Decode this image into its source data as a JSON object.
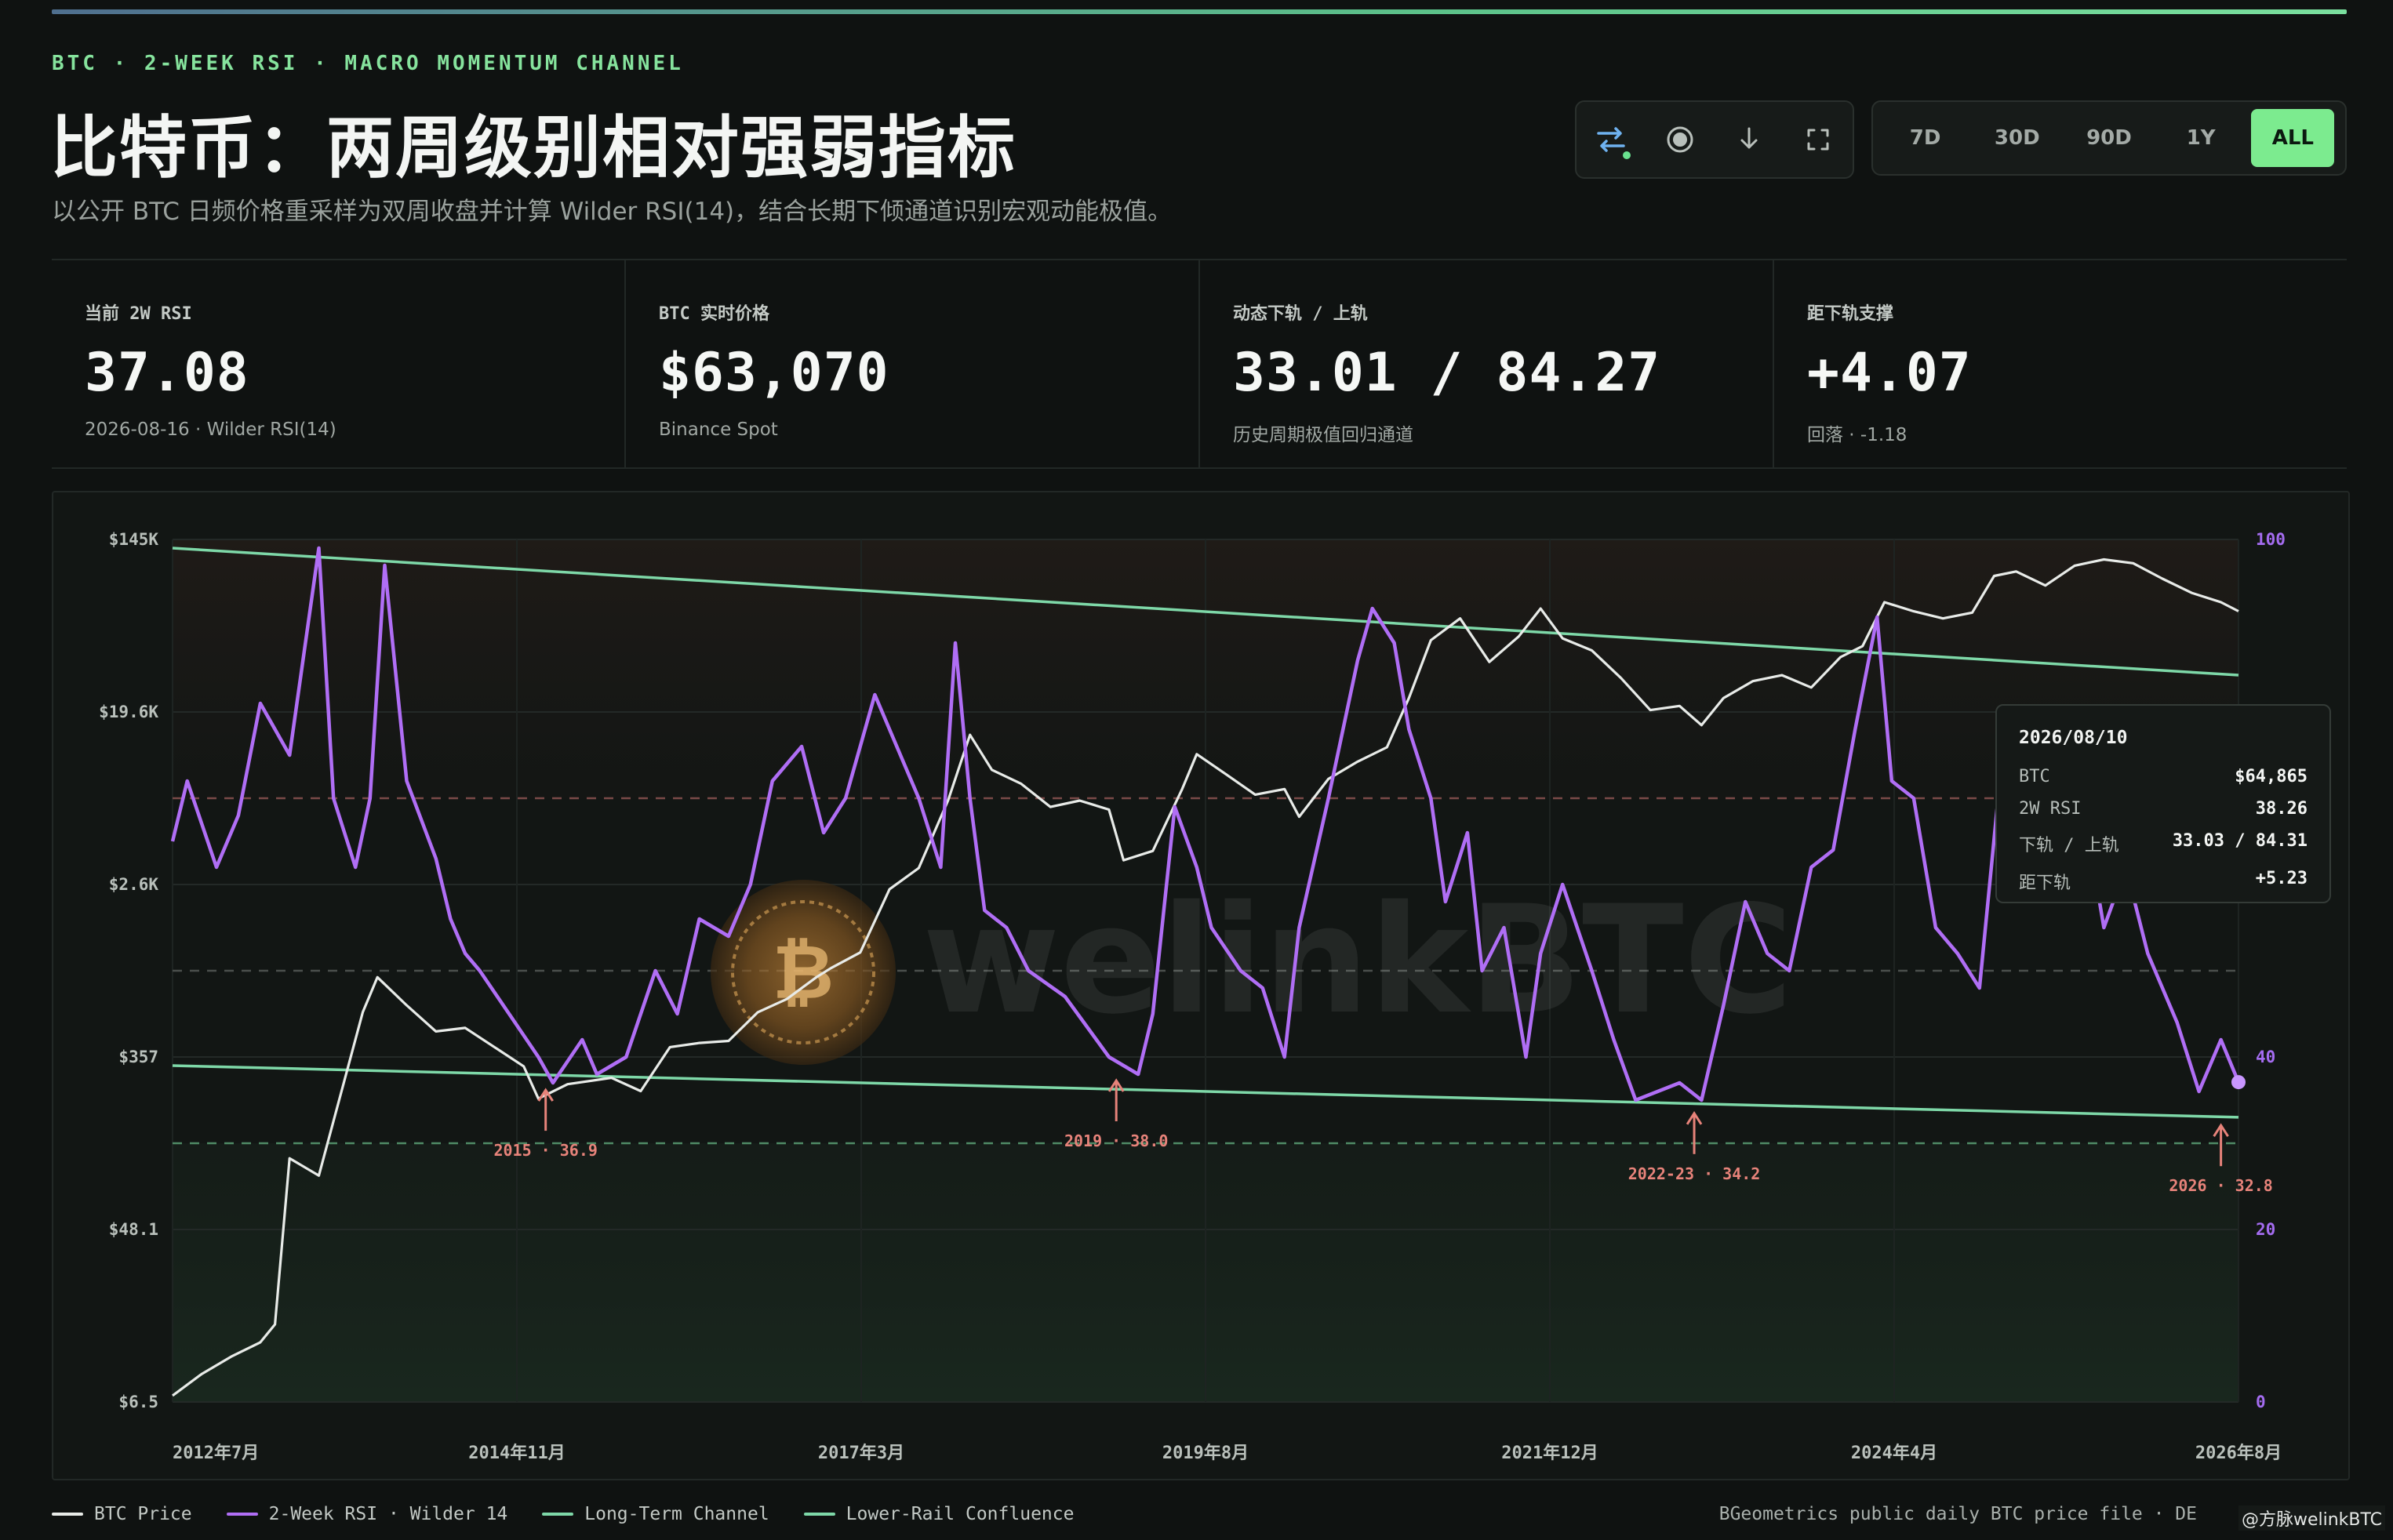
{
  "header": {
    "eyebrow": "BTC · 2-WEEK RSI · MACRO MOMENTUM CHANNEL",
    "title": "比特币：两周级别相对强弱指标",
    "subtitle": "以公开 BTC 日频价格重采样为双周收盘并计算 Wilder RSI(14)，结合长期下倾通道识别宏观动能极值。"
  },
  "toolbar": {
    "icons": [
      "swap-arrows-icon",
      "record-circle-icon",
      "download-arrow-icon",
      "fullscreen-icon"
    ],
    "ranges": [
      "7D",
      "30D",
      "90D",
      "1Y",
      "ALL"
    ],
    "active_range": "ALL",
    "accent": "#7ceb8f"
  },
  "stats": [
    {
      "label": "当前 2W RSI",
      "value": "37.08",
      "sub": "2026-08-16 · Wilder RSI(14)"
    },
    {
      "label": "BTC 实时价格",
      "value": "$63,070",
      "sub": "Binance Spot"
    },
    {
      "label": "动态下轨 / 上轨",
      "value": "33.01 / 84.27",
      "sub": "历史周期极值回归通道"
    },
    {
      "label": "距下轨支撑",
      "value": "+4.07",
      "sub": "回落 · -1.18"
    }
  ],
  "tooltip": {
    "date": "2026/08/10",
    "rows": [
      {
        "k": "BTC",
        "v": "$64,865"
      },
      {
        "k": "2W RSI",
        "v": "38.26"
      },
      {
        "k": "下轨 / 上轨",
        "v": "33.03 / 84.31"
      },
      {
        "k": "距下轨",
        "v": "+5.23"
      }
    ]
  },
  "legend": {
    "items": [
      {
        "label": "BTC Price",
        "color": "#e8ebe8"
      },
      {
        "label": "2-Week RSI · Wilder 14",
        "color": "#b06ef5"
      },
      {
        "label": "Long-Term Channel",
        "color": "#7ed8a8"
      },
      {
        "label": "Lower-Rail Confluence",
        "color": "#7ed8a8"
      }
    ],
    "source": "BGeometrics public daily BTC price file · DE",
    "credit": "@方脉welinkBTC"
  },
  "watermark": "welinkBTC",
  "chart_data": {
    "type": "line",
    "x_tick_labels": [
      "2012年7月",
      "2014年11月",
      "2017年3月",
      "2019年8月",
      "2021年12月",
      "2024年4月",
      "2026年8月"
    ],
    "left_axis": {
      "scale": "log",
      "tick_labels": [
        "$145K",
        "$19.6K",
        "$2.6K",
        "$357",
        "$48.1",
        "$6.5"
      ],
      "range": [
        6.5,
        145000
      ]
    },
    "right_axis": {
      "tick_labels": [
        "100",
        "40",
        "20",
        "0"
      ],
      "range": [
        0,
        100
      ]
    },
    "reference_lines": [
      70,
      50,
      30
    ],
    "series": [
      {
        "name": "BTC Price",
        "color": "#e8ebe8",
        "x": [
          2012.5,
          2012.7,
          2012.9,
          2013.1,
          2013.2,
          2013.3,
          2013.5,
          2013.8,
          2013.9,
          2014.1,
          2014.3,
          2014.5,
          2014.7,
          2014.9,
          2015.0,
          2015.2,
          2015.5,
          2015.7,
          2015.9,
          2016.1,
          2016.3,
          2016.5,
          2016.7,
          2016.9,
          2017.0,
          2017.2,
          2017.4,
          2017.6,
          2017.8,
          2017.95,
          2018.1,
          2018.3,
          2018.5,
          2018.7,
          2018.9,
          2019.0,
          2019.2,
          2019.4,
          2019.5,
          2019.7,
          2019.9,
          2020.1,
          2020.2,
          2020.4,
          2020.6,
          2020.8,
          2020.95,
          2021.1,
          2021.3,
          2021.5,
          2021.7,
          2021.85,
          2022.0,
          2022.2,
          2022.4,
          2022.6,
          2022.8,
          2022.95,
          2023.1,
          2023.3,
          2023.5,
          2023.7,
          2023.9,
          2024.05,
          2024.2,
          2024.4,
          2024.6,
          2024.8,
          2024.95,
          2025.1,
          2025.3,
          2025.5,
          2025.7,
          2025.9,
          2026.1,
          2026.3,
          2026.5,
          2026.62
        ],
        "values": [
          7,
          9,
          11,
          13,
          16,
          110,
          90,
          600,
          900,
          650,
          480,
          500,
          400,
          320,
          220,
          260,
          280,
          240,
          400,
          420,
          430,
          600,
          700,
          900,
          1000,
          1200,
          2500,
          3200,
          7000,
          15000,
          10000,
          8500,
          6500,
          7000,
          6300,
          3500,
          3900,
          8000,
          12000,
          9500,
          7500,
          8000,
          5800,
          9000,
          11000,
          13000,
          23000,
          45000,
          58000,
          35000,
          47000,
          65000,
          46000,
          40000,
          29000,
          20000,
          21000,
          16800,
          23000,
          28000,
          30000,
          26000,
          37000,
          42000,
          70000,
          63000,
          58000,
          62000,
          95000,
          100000,
          85000,
          107000,
          115000,
          110000,
          92000,
          78000,
          70000,
          63070
        ]
      },
      {
        "name": "2-Week RSI · Wilder 14",
        "color": "#b06ef5",
        "x": [
          2012.5,
          2012.6,
          2012.8,
          2012.95,
          2013.1,
          2013.3,
          2013.5,
          2013.6,
          2013.75,
          2013.85,
          2013.95,
          2014.1,
          2014.3,
          2014.4,
          2014.5,
          2014.6,
          2014.8,
          2015.0,
          2015.1,
          2015.3,
          2015.4,
          2015.6,
          2015.8,
          2015.95,
          2016.1,
          2016.3,
          2016.45,
          2016.6,
          2016.8,
          2016.95,
          2017.1,
          2017.3,
          2017.5,
          2017.6,
          2017.75,
          2017.85,
          2017.95,
          2018.05,
          2018.2,
          2018.35,
          2018.6,
          2018.9,
          2019.1,
          2019.2,
          2019.35,
          2019.5,
          2019.6,
          2019.8,
          2019.95,
          2020.1,
          2020.2,
          2020.4,
          2020.6,
          2020.7,
          2020.85,
          2020.95,
          2021.1,
          2021.2,
          2021.35,
          2021.45,
          2021.6,
          2021.75,
          2021.85,
          2022.0,
          2022.2,
          2022.35,
          2022.5,
          2022.65,
          2022.8,
          2022.95,
          2023.1,
          2023.25,
          2023.4,
          2023.55,
          2023.7,
          2023.85,
          2024.0,
          2024.15,
          2024.25,
          2024.4,
          2024.55,
          2024.7,
          2024.85,
          2025.0,
          2025.2,
          2025.4,
          2025.55,
          2025.7,
          2025.85,
          2026.0,
          2026.2,
          2026.35,
          2026.5,
          2026.62
        ],
        "values": [
          65,
          72,
          62,
          68,
          81,
          75,
          99,
          70,
          62,
          70,
          97,
          72,
          63,
          56,
          52,
          50,
          45,
          40,
          37,
          42,
          38,
          40,
          50,
          45,
          56,
          54,
          60,
          72,
          76,
          66,
          70,
          82,
          74,
          70,
          62,
          88,
          70,
          57,
          55,
          50,
          47,
          40,
          38,
          45,
          69,
          62,
          55,
          50,
          48,
          40,
          55,
          70,
          86,
          92,
          88,
          78,
          70,
          58,
          66,
          50,
          55,
          40,
          52,
          60,
          50,
          42,
          35,
          36,
          37,
          35,
          46,
          58,
          52,
          50,
          62,
          64,
          78,
          91,
          72,
          70,
          55,
          52,
          48,
          74,
          60,
          66,
          70,
          55,
          62,
          52,
          44,
          36,
          42,
          37.08
        ]
      }
    ],
    "channel": {
      "upper": [
        [
          2012.5,
          99.0
        ],
        [
          2026.62,
          84.27
        ]
      ],
      "lower": [
        [
          2012.5,
          39.0
        ],
        [
          2026.62,
          33.01
        ]
      ]
    },
    "annotations": [
      {
        "label": "2015 · 36.9",
        "x": 2015.05,
        "y": 36.9
      },
      {
        "label": "2019 · 38.0",
        "x": 2018.95,
        "y": 38.0
      },
      {
        "label": "2022-23 · 34.2",
        "x": 2022.9,
        "y": 34.2
      },
      {
        "label": "2026 · 32.8",
        "x": 2026.5,
        "y": 32.8
      }
    ]
  }
}
